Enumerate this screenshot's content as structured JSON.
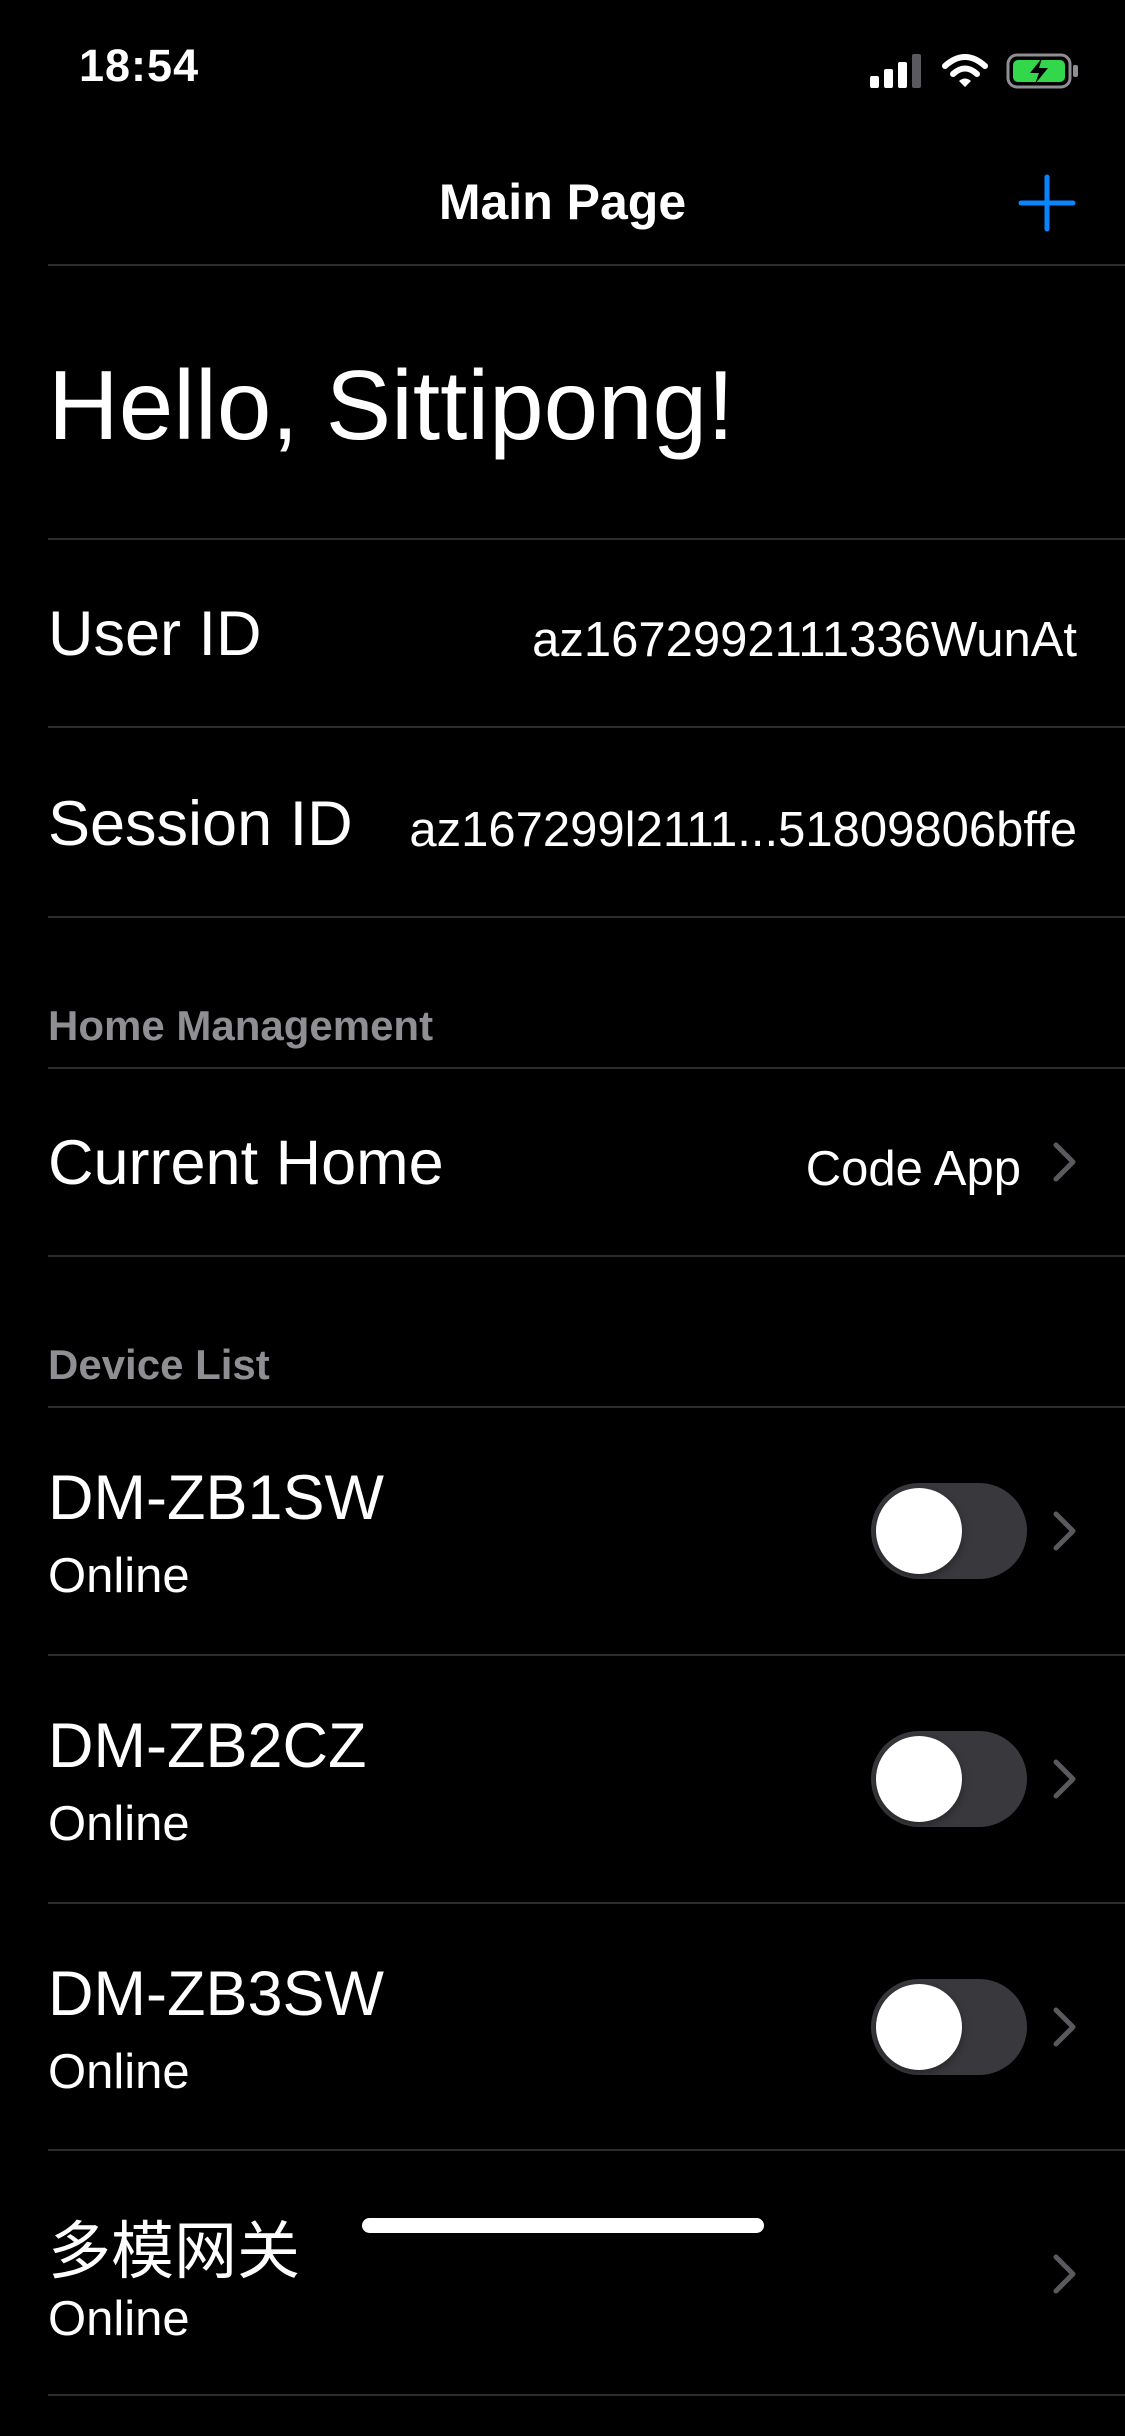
{
  "status_bar": {
    "time": "18:54",
    "icons": [
      "signal-icon",
      "wifi-icon",
      "battery-charging-icon"
    ],
    "battery_color": "#32d74b"
  },
  "nav": {
    "title": "Main Page",
    "add_icon": "plus-icon",
    "accent_color": "#0a84ff"
  },
  "greeting": "Hello, Sittipong!",
  "user_info": [
    {
      "label": "User ID",
      "value": "az1672992111336WunAt"
    },
    {
      "label": "Session ID",
      "value": "az167299l2111...51809806bffe"
    }
  ],
  "home_management": {
    "header": "Home Management",
    "current_home_label": "Current Home",
    "current_home_value": "Code App"
  },
  "device_list": {
    "header": "Device List",
    "devices": [
      {
        "name": "DM-ZB1SW",
        "status": "Online",
        "switch_on": false
      },
      {
        "name": "DM-ZB2CZ",
        "status": "Online",
        "switch_on": false
      },
      {
        "name": "DM-ZB3SW",
        "status": "Online",
        "switch_on": false
      },
      {
        "name": "多模网关",
        "status": "Online"
      }
    ]
  }
}
